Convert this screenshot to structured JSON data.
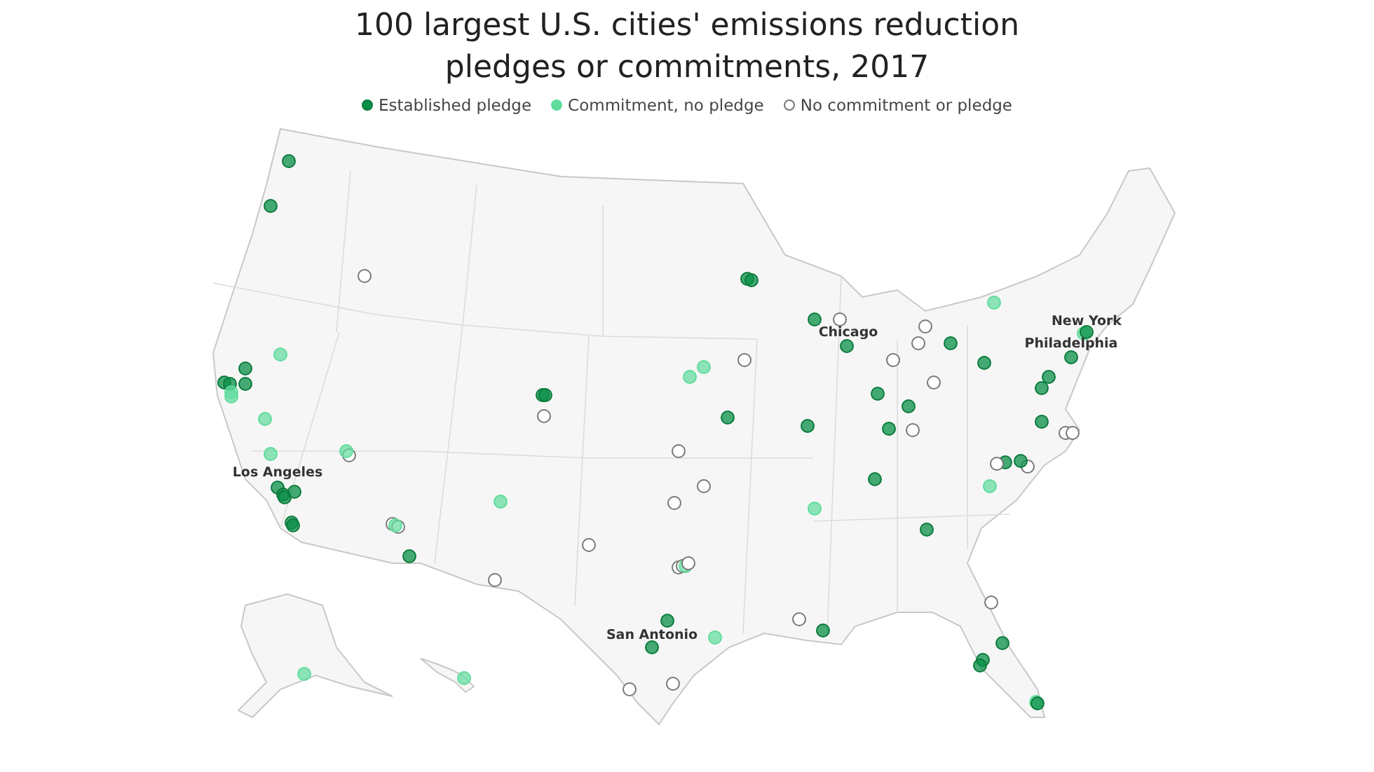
{
  "title": "100 largest U.S. cities' emissions reduction pledges or commitments, 2017",
  "legend": [
    {
      "kind": "established",
      "label": "Established pledge"
    },
    {
      "kind": "commitment",
      "label": "Commitment, no pledge"
    },
    {
      "kind": "none",
      "label": "No commitment or pledge"
    }
  ],
  "city_labels": [
    "Los Angeles",
    "San Antonio",
    "Chicago",
    "New York",
    "Philadelphia"
  ],
  "cities": [
    {
      "kind": "established"
    },
    {
      "kind": "established"
    },
    {
      "kind": "none"
    },
    {
      "kind": "established"
    },
    {
      "kind": "established"
    },
    {
      "kind": "established"
    },
    {
      "kind": "established"
    },
    {
      "kind": "commitment"
    },
    {
      "kind": "commitment"
    },
    {
      "kind": "commitment"
    },
    {
      "kind": "commitment"
    },
    {
      "kind": "commitment"
    },
    {
      "kind": "none"
    },
    {
      "kind": "commitment"
    },
    {
      "kind": "established"
    },
    {
      "kind": "established"
    },
    {
      "kind": "established"
    },
    {
      "kind": "established"
    },
    {
      "kind": "established"
    },
    {
      "kind": "established"
    },
    {
      "kind": "none"
    },
    {
      "kind": "none"
    },
    {
      "kind": "commitment"
    },
    {
      "kind": "established"
    },
    {
      "kind": "established"
    },
    {
      "kind": "established"
    },
    {
      "kind": "none"
    },
    {
      "kind": "commitment"
    },
    {
      "kind": "none"
    },
    {
      "kind": "established"
    },
    {
      "kind": "established"
    },
    {
      "kind": "commitment"
    },
    {
      "kind": "commitment"
    },
    {
      "kind": "none"
    },
    {
      "kind": "established"
    },
    {
      "kind": "none"
    },
    {
      "kind": "none"
    },
    {
      "kind": "none"
    },
    {
      "kind": "none"
    },
    {
      "kind": "none"
    },
    {
      "kind": "none"
    },
    {
      "kind": "commitment"
    },
    {
      "kind": "none"
    },
    {
      "kind": "established"
    },
    {
      "kind": "established"
    },
    {
      "kind": "commitment"
    },
    {
      "kind": "none"
    },
    {
      "kind": "none"
    },
    {
      "kind": "established"
    },
    {
      "kind": "none"
    },
    {
      "kind": "established"
    },
    {
      "kind": "none"
    },
    {
      "kind": "established"
    },
    {
      "kind": "none"
    },
    {
      "kind": "none"
    },
    {
      "kind": "none"
    },
    {
      "kind": "established"
    },
    {
      "kind": "established"
    },
    {
      "kind": "none"
    },
    {
      "kind": "established"
    },
    {
      "kind": "established"
    },
    {
      "kind": "none"
    },
    {
      "kind": "established"
    },
    {
      "kind": "commitment"
    },
    {
      "kind": "established"
    },
    {
      "kind": "established"
    },
    {
      "kind": "commitment"
    },
    {
      "kind": "established"
    },
    {
      "kind": "commitment"
    },
    {
      "kind": "established"
    },
    {
      "kind": "established"
    },
    {
      "kind": "established"
    },
    {
      "kind": "established"
    },
    {
      "kind": "none"
    },
    {
      "kind": "none"
    },
    {
      "kind": "established"
    },
    {
      "kind": "established"
    },
    {
      "kind": "none"
    },
    {
      "kind": "none"
    },
    {
      "kind": "commitment"
    },
    {
      "kind": "established"
    },
    {
      "kind": "none"
    },
    {
      "kind": "established"
    },
    {
      "kind": "established"
    },
    {
      "kind": "established"
    },
    {
      "kind": "commitment"
    },
    {
      "kind": "established"
    },
    {
      "kind": "commitment"
    },
    {
      "kind": "commitment"
    }
  ]
}
